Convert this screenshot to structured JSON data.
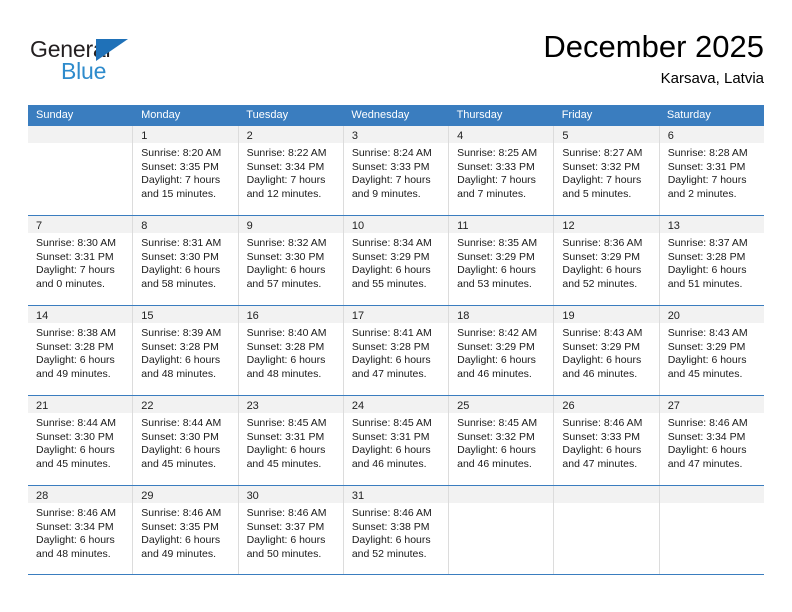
{
  "brand": {
    "name_top": "General",
    "name_bottom": "Blue",
    "accent_color": "#2e8bcc",
    "triangle_color": "#1f71b8",
    "top_color": "#231f20"
  },
  "header": {
    "month_title": "December 2025",
    "location": "Karsava, Latvia"
  },
  "calendar": {
    "header_bg": "#3a7dbf",
    "daynum_bg": "#f2f2f2",
    "grid_line": "#dcdcdc",
    "weekday_headers": [
      "Sunday",
      "Monday",
      "Tuesday",
      "Wednesday",
      "Thursday",
      "Friday",
      "Saturday"
    ],
    "weeks": [
      [
        {
          "day": "",
          "sunrise": "",
          "sunset": "",
          "daylight_line1": "",
          "daylight_line2": ""
        },
        {
          "day": "1",
          "sunrise": "Sunrise: 8:20 AM",
          "sunset": "Sunset: 3:35 PM",
          "daylight_line1": "Daylight: 7 hours",
          "daylight_line2": "and 15 minutes."
        },
        {
          "day": "2",
          "sunrise": "Sunrise: 8:22 AM",
          "sunset": "Sunset: 3:34 PM",
          "daylight_line1": "Daylight: 7 hours",
          "daylight_line2": "and 12 minutes."
        },
        {
          "day": "3",
          "sunrise": "Sunrise: 8:24 AM",
          "sunset": "Sunset: 3:33 PM",
          "daylight_line1": "Daylight: 7 hours",
          "daylight_line2": "and 9 minutes."
        },
        {
          "day": "4",
          "sunrise": "Sunrise: 8:25 AM",
          "sunset": "Sunset: 3:33 PM",
          "daylight_line1": "Daylight: 7 hours",
          "daylight_line2": "and 7 minutes."
        },
        {
          "day": "5",
          "sunrise": "Sunrise: 8:27 AM",
          "sunset": "Sunset: 3:32 PM",
          "daylight_line1": "Daylight: 7 hours",
          "daylight_line2": "and 5 minutes."
        },
        {
          "day": "6",
          "sunrise": "Sunrise: 8:28 AM",
          "sunset": "Sunset: 3:31 PM",
          "daylight_line1": "Daylight: 7 hours",
          "daylight_line2": "and 2 minutes."
        }
      ],
      [
        {
          "day": "7",
          "sunrise": "Sunrise: 8:30 AM",
          "sunset": "Sunset: 3:31 PM",
          "daylight_line1": "Daylight: 7 hours",
          "daylight_line2": "and 0 minutes."
        },
        {
          "day": "8",
          "sunrise": "Sunrise: 8:31 AM",
          "sunset": "Sunset: 3:30 PM",
          "daylight_line1": "Daylight: 6 hours",
          "daylight_line2": "and 58 minutes."
        },
        {
          "day": "9",
          "sunrise": "Sunrise: 8:32 AM",
          "sunset": "Sunset: 3:30 PM",
          "daylight_line1": "Daylight: 6 hours",
          "daylight_line2": "and 57 minutes."
        },
        {
          "day": "10",
          "sunrise": "Sunrise: 8:34 AM",
          "sunset": "Sunset: 3:29 PM",
          "daylight_line1": "Daylight: 6 hours",
          "daylight_line2": "and 55 minutes."
        },
        {
          "day": "11",
          "sunrise": "Sunrise: 8:35 AM",
          "sunset": "Sunset: 3:29 PM",
          "daylight_line1": "Daylight: 6 hours",
          "daylight_line2": "and 53 minutes."
        },
        {
          "day": "12",
          "sunrise": "Sunrise: 8:36 AM",
          "sunset": "Sunset: 3:29 PM",
          "daylight_line1": "Daylight: 6 hours",
          "daylight_line2": "and 52 minutes."
        },
        {
          "day": "13",
          "sunrise": "Sunrise: 8:37 AM",
          "sunset": "Sunset: 3:28 PM",
          "daylight_line1": "Daylight: 6 hours",
          "daylight_line2": "and 51 minutes."
        }
      ],
      [
        {
          "day": "14",
          "sunrise": "Sunrise: 8:38 AM",
          "sunset": "Sunset: 3:28 PM",
          "daylight_line1": "Daylight: 6 hours",
          "daylight_line2": "and 49 minutes."
        },
        {
          "day": "15",
          "sunrise": "Sunrise: 8:39 AM",
          "sunset": "Sunset: 3:28 PM",
          "daylight_line1": "Daylight: 6 hours",
          "daylight_line2": "and 48 minutes."
        },
        {
          "day": "16",
          "sunrise": "Sunrise: 8:40 AM",
          "sunset": "Sunset: 3:28 PM",
          "daylight_line1": "Daylight: 6 hours",
          "daylight_line2": "and 48 minutes."
        },
        {
          "day": "17",
          "sunrise": "Sunrise: 8:41 AM",
          "sunset": "Sunset: 3:28 PM",
          "daylight_line1": "Daylight: 6 hours",
          "daylight_line2": "and 47 minutes."
        },
        {
          "day": "18",
          "sunrise": "Sunrise: 8:42 AM",
          "sunset": "Sunset: 3:29 PM",
          "daylight_line1": "Daylight: 6 hours",
          "daylight_line2": "and 46 minutes."
        },
        {
          "day": "19",
          "sunrise": "Sunrise: 8:43 AM",
          "sunset": "Sunset: 3:29 PM",
          "daylight_line1": "Daylight: 6 hours",
          "daylight_line2": "and 46 minutes."
        },
        {
          "day": "20",
          "sunrise": "Sunrise: 8:43 AM",
          "sunset": "Sunset: 3:29 PM",
          "daylight_line1": "Daylight: 6 hours",
          "daylight_line2": "and 45 minutes."
        }
      ],
      [
        {
          "day": "21",
          "sunrise": "Sunrise: 8:44 AM",
          "sunset": "Sunset: 3:30 PM",
          "daylight_line1": "Daylight: 6 hours",
          "daylight_line2": "and 45 minutes."
        },
        {
          "day": "22",
          "sunrise": "Sunrise: 8:44 AM",
          "sunset": "Sunset: 3:30 PM",
          "daylight_line1": "Daylight: 6 hours",
          "daylight_line2": "and 45 minutes."
        },
        {
          "day": "23",
          "sunrise": "Sunrise: 8:45 AM",
          "sunset": "Sunset: 3:31 PM",
          "daylight_line1": "Daylight: 6 hours",
          "daylight_line2": "and 45 minutes."
        },
        {
          "day": "24",
          "sunrise": "Sunrise: 8:45 AM",
          "sunset": "Sunset: 3:31 PM",
          "daylight_line1": "Daylight: 6 hours",
          "daylight_line2": "and 46 minutes."
        },
        {
          "day": "25",
          "sunrise": "Sunrise: 8:45 AM",
          "sunset": "Sunset: 3:32 PM",
          "daylight_line1": "Daylight: 6 hours",
          "daylight_line2": "and 46 minutes."
        },
        {
          "day": "26",
          "sunrise": "Sunrise: 8:46 AM",
          "sunset": "Sunset: 3:33 PM",
          "daylight_line1": "Daylight: 6 hours",
          "daylight_line2": "and 47 minutes."
        },
        {
          "day": "27",
          "sunrise": "Sunrise: 8:46 AM",
          "sunset": "Sunset: 3:34 PM",
          "daylight_line1": "Daylight: 6 hours",
          "daylight_line2": "and 47 minutes."
        }
      ],
      [
        {
          "day": "28",
          "sunrise": "Sunrise: 8:46 AM",
          "sunset": "Sunset: 3:34 PM",
          "daylight_line1": "Daylight: 6 hours",
          "daylight_line2": "and 48 minutes."
        },
        {
          "day": "29",
          "sunrise": "Sunrise: 8:46 AM",
          "sunset": "Sunset: 3:35 PM",
          "daylight_line1": "Daylight: 6 hours",
          "daylight_line2": "and 49 minutes."
        },
        {
          "day": "30",
          "sunrise": "Sunrise: 8:46 AM",
          "sunset": "Sunset: 3:37 PM",
          "daylight_line1": "Daylight: 6 hours",
          "daylight_line2": "and 50 minutes."
        },
        {
          "day": "31",
          "sunrise": "Sunrise: 8:46 AM",
          "sunset": "Sunset: 3:38 PM",
          "daylight_line1": "Daylight: 6 hours",
          "daylight_line2": "and 52 minutes."
        },
        {
          "day": "",
          "sunrise": "",
          "sunset": "",
          "daylight_line1": "",
          "daylight_line2": ""
        },
        {
          "day": "",
          "sunrise": "",
          "sunset": "",
          "daylight_line1": "",
          "daylight_line2": ""
        },
        {
          "day": "",
          "sunrise": "",
          "sunset": "",
          "daylight_line1": "",
          "daylight_line2": ""
        }
      ]
    ]
  }
}
